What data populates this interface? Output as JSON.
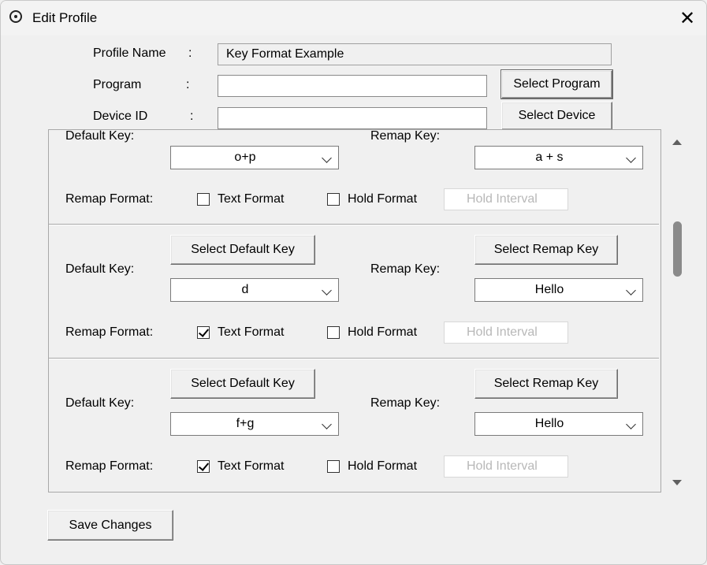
{
  "window": {
    "title": "Edit Profile"
  },
  "form": {
    "profile_name_label": "Profile Name",
    "program_label": "Program",
    "device_id_label": "Device ID",
    "colon": ":",
    "profile_name_value": "Key Format Example",
    "program_value": "",
    "device_id_value": "",
    "select_program_label": "Select Program",
    "select_device_label": "Select Device"
  },
  "mappings": [
    {
      "default_key_label": "Default Key:",
      "remap_key_label": "Remap Key:",
      "default_value": "o+p",
      "remap_value": "a + s",
      "remap_format_label": "Remap Format:",
      "text_format_label": "Text Format",
      "text_format_checked": false,
      "hold_format_label": "Hold Format",
      "hold_format_checked": false,
      "hold_interval_placeholder": "Hold Interval"
    },
    {
      "select_default_key_label": "Select Default Key",
      "select_remap_key_label": "Select Remap Key",
      "default_key_label": "Default Key:",
      "remap_key_label": "Remap Key:",
      "default_value": "d",
      "remap_value": "Hello",
      "remap_format_label": "Remap Format:",
      "text_format_label": "Text Format",
      "text_format_checked": true,
      "hold_format_label": "Hold Format",
      "hold_format_checked": false,
      "hold_interval_placeholder": "Hold Interval"
    },
    {
      "select_default_key_label": "Select Default Key",
      "select_remap_key_label": "Select Remap Key",
      "default_key_label": "Default Key:",
      "remap_key_label": "Remap Key:",
      "default_value": "f+g",
      "remap_value": "Hello",
      "remap_format_label": "Remap Format:",
      "text_format_label": "Text Format",
      "text_format_checked": true,
      "hold_format_label": "Hold Format",
      "hold_format_checked": false,
      "hold_interval_placeholder": "Hold Interval"
    }
  ],
  "footer": {
    "save_changes_label": "Save Changes"
  },
  "icons": {
    "app": "radio-target-icon",
    "close": "close-icon",
    "scroll_up": "triangle-up-icon",
    "scroll_down": "triangle-down-icon"
  }
}
